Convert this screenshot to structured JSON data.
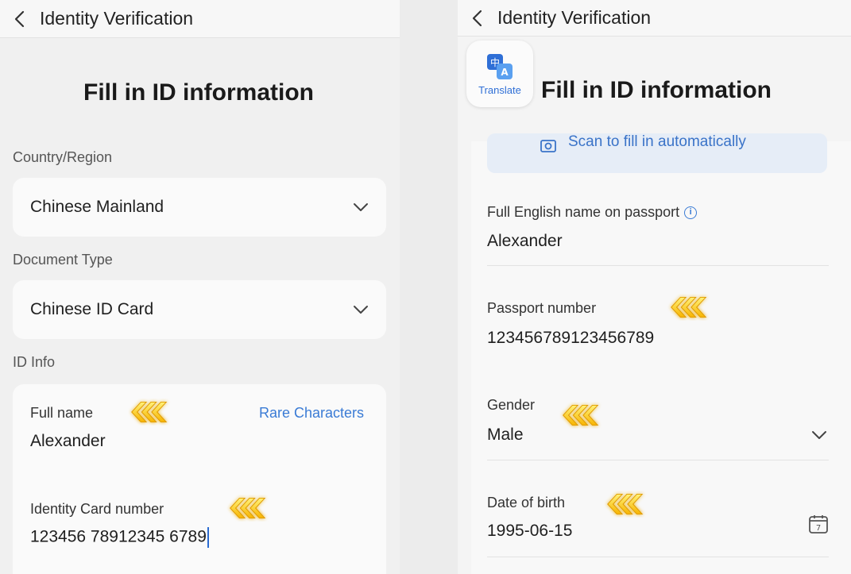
{
  "left": {
    "topbar": {
      "title": "Identity Verification"
    },
    "heading": "Fill in ID information",
    "country": {
      "label": "Country/Region",
      "value": "Chinese Mainland"
    },
    "document": {
      "label": "Document Type",
      "value": "Chinese ID Card"
    },
    "id_info": {
      "label": "ID Info",
      "full_name_label": "Full name",
      "full_name_value": "Alexander",
      "rare_link": "Rare Characters",
      "id_number_label": "Identity Card number",
      "id_number_value": "123456 78912345 6789"
    }
  },
  "right": {
    "topbar": {
      "title": "Identity Verification"
    },
    "translate_label": "Translate",
    "heading": "Fill in ID information",
    "scan_text": "Scan to fill in automatically",
    "english_name": {
      "label": "Full English name on passport",
      "value": "Alexander"
    },
    "passport": {
      "label": "Passport number",
      "value": "123456789123456789"
    },
    "gender": {
      "label": "Gender",
      "value": "Male"
    },
    "dob": {
      "label": "Date of birth",
      "value": "1995-06-15"
    }
  },
  "icons": {
    "back": "chevron-left-icon",
    "dropdown": "chevron-down-icon",
    "calendar": "calendar-icon",
    "info": "info-icon",
    "camera": "camera-icon",
    "translate": "translate-icon",
    "highlight": "triple-arrow-highlight-icon"
  },
  "colors": {
    "accent_blue": "#3a7bd5",
    "highlight_yellow": "#ffd23a"
  }
}
